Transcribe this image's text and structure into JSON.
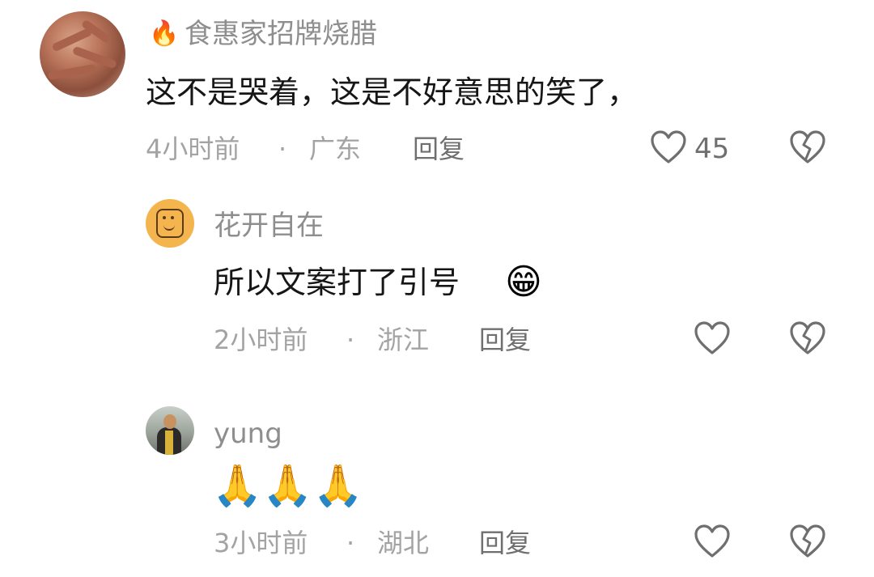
{
  "comments": [
    {
      "username": "食惠家招牌烧腊",
      "user_icon": "fire-emoji",
      "user_icon_glyph": "🔥",
      "text": "这不是哭着，这是不好意思的笑了，",
      "time": "4小时前",
      "separator": "·",
      "location": "广东",
      "reply_label": "回复",
      "like_count": "45"
    },
    {
      "username": "花开自在",
      "text": "所以文案打了引号",
      "emoji": "😁",
      "time": "2小时前",
      "separator": "·",
      "location": "浙江",
      "reply_label": "回复"
    },
    {
      "username": "yung",
      "emoji_text": "🙏🙏🙏",
      "time": "3小时前",
      "separator": "·",
      "location": "湖北",
      "reply_label": "回复"
    }
  ],
  "icons": {
    "like": "heart-outline-icon",
    "dislike": "broken-heart-icon"
  },
  "colors": {
    "text_primary": "#161616",
    "text_secondary": "#8e8e8e",
    "text_meta": "#a3a3a3",
    "avatar_flower": "#f4b44e"
  }
}
